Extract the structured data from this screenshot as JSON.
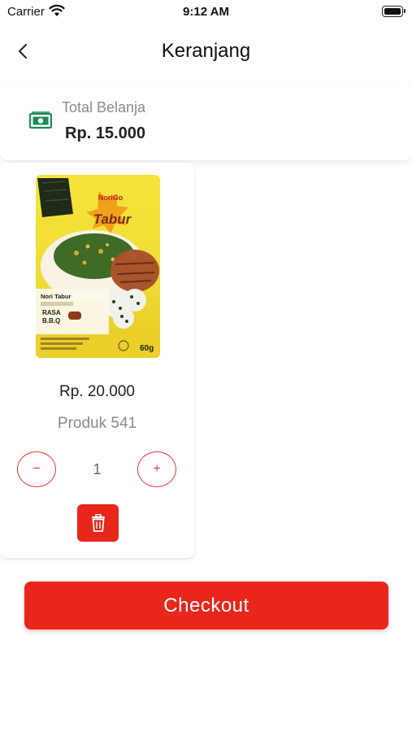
{
  "status_bar": {
    "carrier": "Carrier",
    "time": "9:12 AM"
  },
  "header": {
    "title": "Keranjang"
  },
  "summary": {
    "label": "Total Belanja",
    "value": "Rp. 15.000"
  },
  "cart_items": [
    {
      "price": "Rp. 20.000",
      "name": "Produk 541",
      "quantity": "1",
      "image_text": {
        "brand": "NoriGo",
        "product": "Tabur",
        "variant_title": "Nori Tabur",
        "flavor_line1": "RASA",
        "flavor_line2": "B.B.Q",
        "weight": "60g"
      }
    }
  ],
  "buttons": {
    "minus": "−",
    "plus": "+",
    "checkout": "Checkout"
  },
  "colors": {
    "accent": "#e8261b",
    "money_icon": "#1f8a55"
  }
}
